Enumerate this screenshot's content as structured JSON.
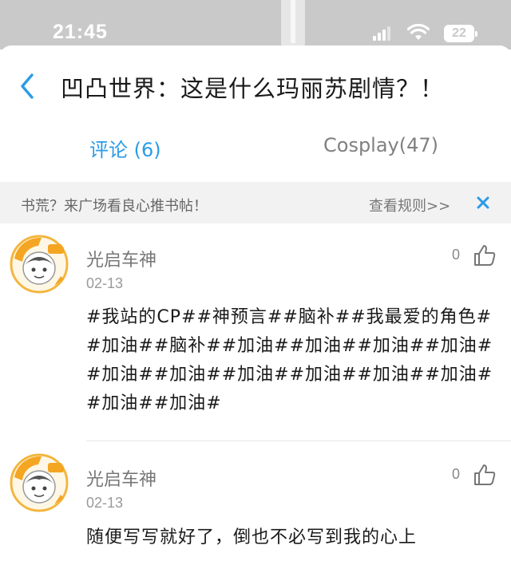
{
  "status_bar": {
    "time": "21:45",
    "battery": "22"
  },
  "header": {
    "title": "凹凸世界：这是什么玛丽苏剧情？！"
  },
  "tabs": [
    {
      "label": "评论 (6)",
      "active": true
    },
    {
      "label": "Cosplay(47)",
      "active": false
    }
  ],
  "notice": {
    "text": "书荒？来广场看良心推书帖！",
    "rules_link": "查看规则>>"
  },
  "comments": [
    {
      "username": "光启车神",
      "date": "02-13",
      "likes": "0",
      "body": "#我站的CP##神预言##脑补##我最爱的角色##加油##脑补##加油##加油##加油##加油##加油##加油##加油##加油##加油##加油##加油##加油#"
    },
    {
      "username": "光启车神",
      "date": "02-13",
      "likes": "0",
      "body": "随便写写就好了，倒也不必写到我的心上"
    }
  ],
  "colors": {
    "accent": "#2b9be8",
    "status_bar": "#c9c9c9",
    "notice_bg": "#f2f2f2"
  }
}
